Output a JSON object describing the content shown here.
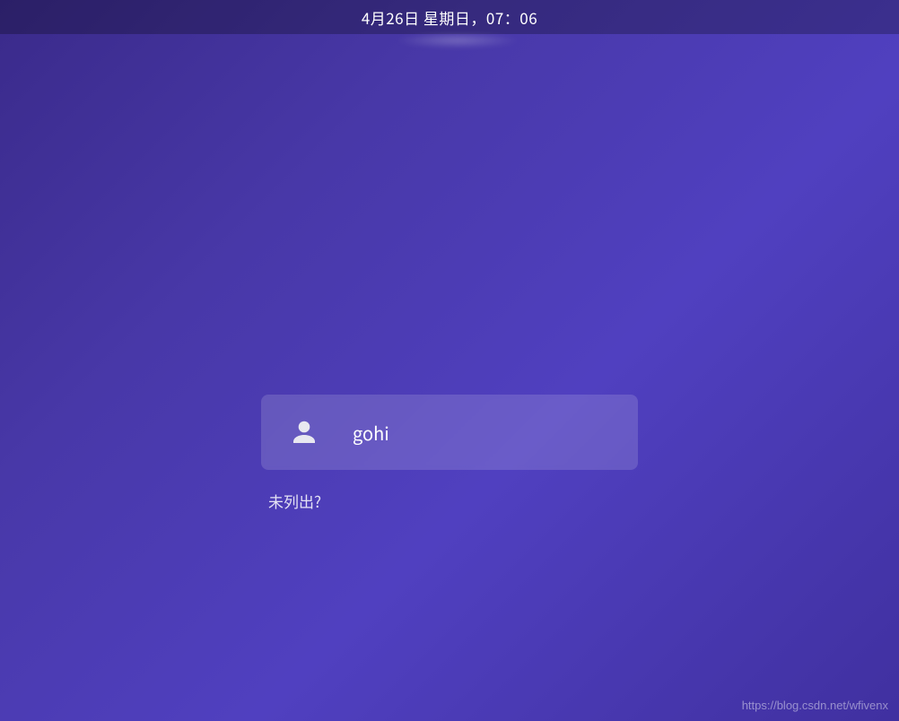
{
  "topbar": {
    "datetime": "4月26日 星期日，07：06"
  },
  "login": {
    "user": {
      "name": "gohi",
      "icon": "user-icon"
    },
    "not_listed_label": "未列出?"
  },
  "watermark": {
    "text": "https://blog.csdn.net/wfivenx"
  }
}
